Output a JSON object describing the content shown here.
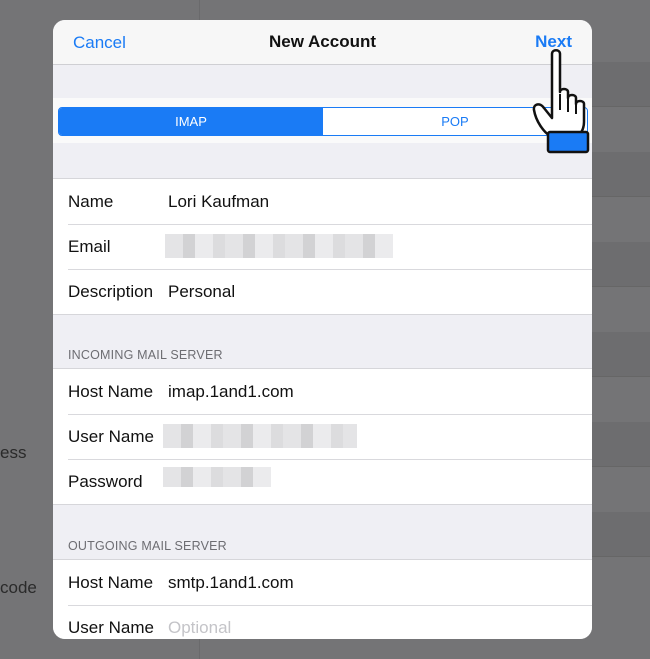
{
  "background": {
    "partial_labels": [
      "ess",
      "code"
    ]
  },
  "navbar": {
    "cancel_label": "Cancel",
    "title": "New Account",
    "next_label": "Next"
  },
  "segmented_control": {
    "options": [
      "IMAP",
      "POP"
    ],
    "selected": "IMAP"
  },
  "account": {
    "name_label": "Name",
    "name_value": "Lori Kaufman",
    "email_label": "Email",
    "description_label": "Description",
    "description_value": "Personal"
  },
  "incoming": {
    "header": "INCOMING MAIL SERVER",
    "host_label": "Host Name",
    "host_value": "imap.1and1.com",
    "user_label": "User Name",
    "password_label": "Password"
  },
  "outgoing": {
    "header": "OUTGOING MAIL SERVER",
    "host_label": "Host Name",
    "host_value": "smtp.1and1.com",
    "user_label": "User Name",
    "user_placeholder": "Optional"
  },
  "colors": {
    "accent": "#1a7bf5",
    "group_background": "#efeff4",
    "section_header": "#6d6d72",
    "placeholder": "#c4c4c8"
  },
  "icons": [
    "hand-pointer-cursor-icon"
  ]
}
